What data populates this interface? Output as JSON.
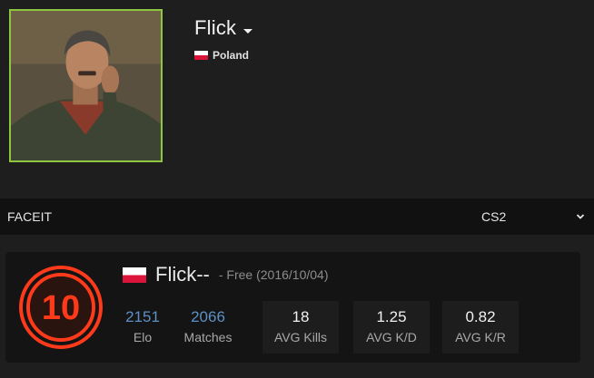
{
  "profile": {
    "name": "Flick",
    "country": "Poland"
  },
  "provider_bar": {
    "provider": "FACEIT",
    "game": "CS2"
  },
  "card": {
    "level": "10",
    "nickname": "Flick--",
    "meta": "- Free (2016/10/04)",
    "stats_plain": [
      {
        "value": "2151",
        "label": "Elo"
      },
      {
        "value": "2066",
        "label": "Matches"
      }
    ],
    "stats_boxed": [
      {
        "value": "18",
        "label": "AVG Kills"
      },
      {
        "value": "1.25",
        "label": "AVG K/D"
      },
      {
        "value": "0.82",
        "label": "AVG K/R"
      }
    ]
  },
  "colors": {
    "avatar_border": "#8dc63f",
    "level_badge": "#ff3a1a",
    "stat_accent": "#5d90c4",
    "flag_red": "#dc143c"
  },
  "icons": {
    "name_dropdown": "caret-down-icon",
    "game_dropdown": "chevron-down-icon",
    "level": "faceit-level-10-icon"
  }
}
